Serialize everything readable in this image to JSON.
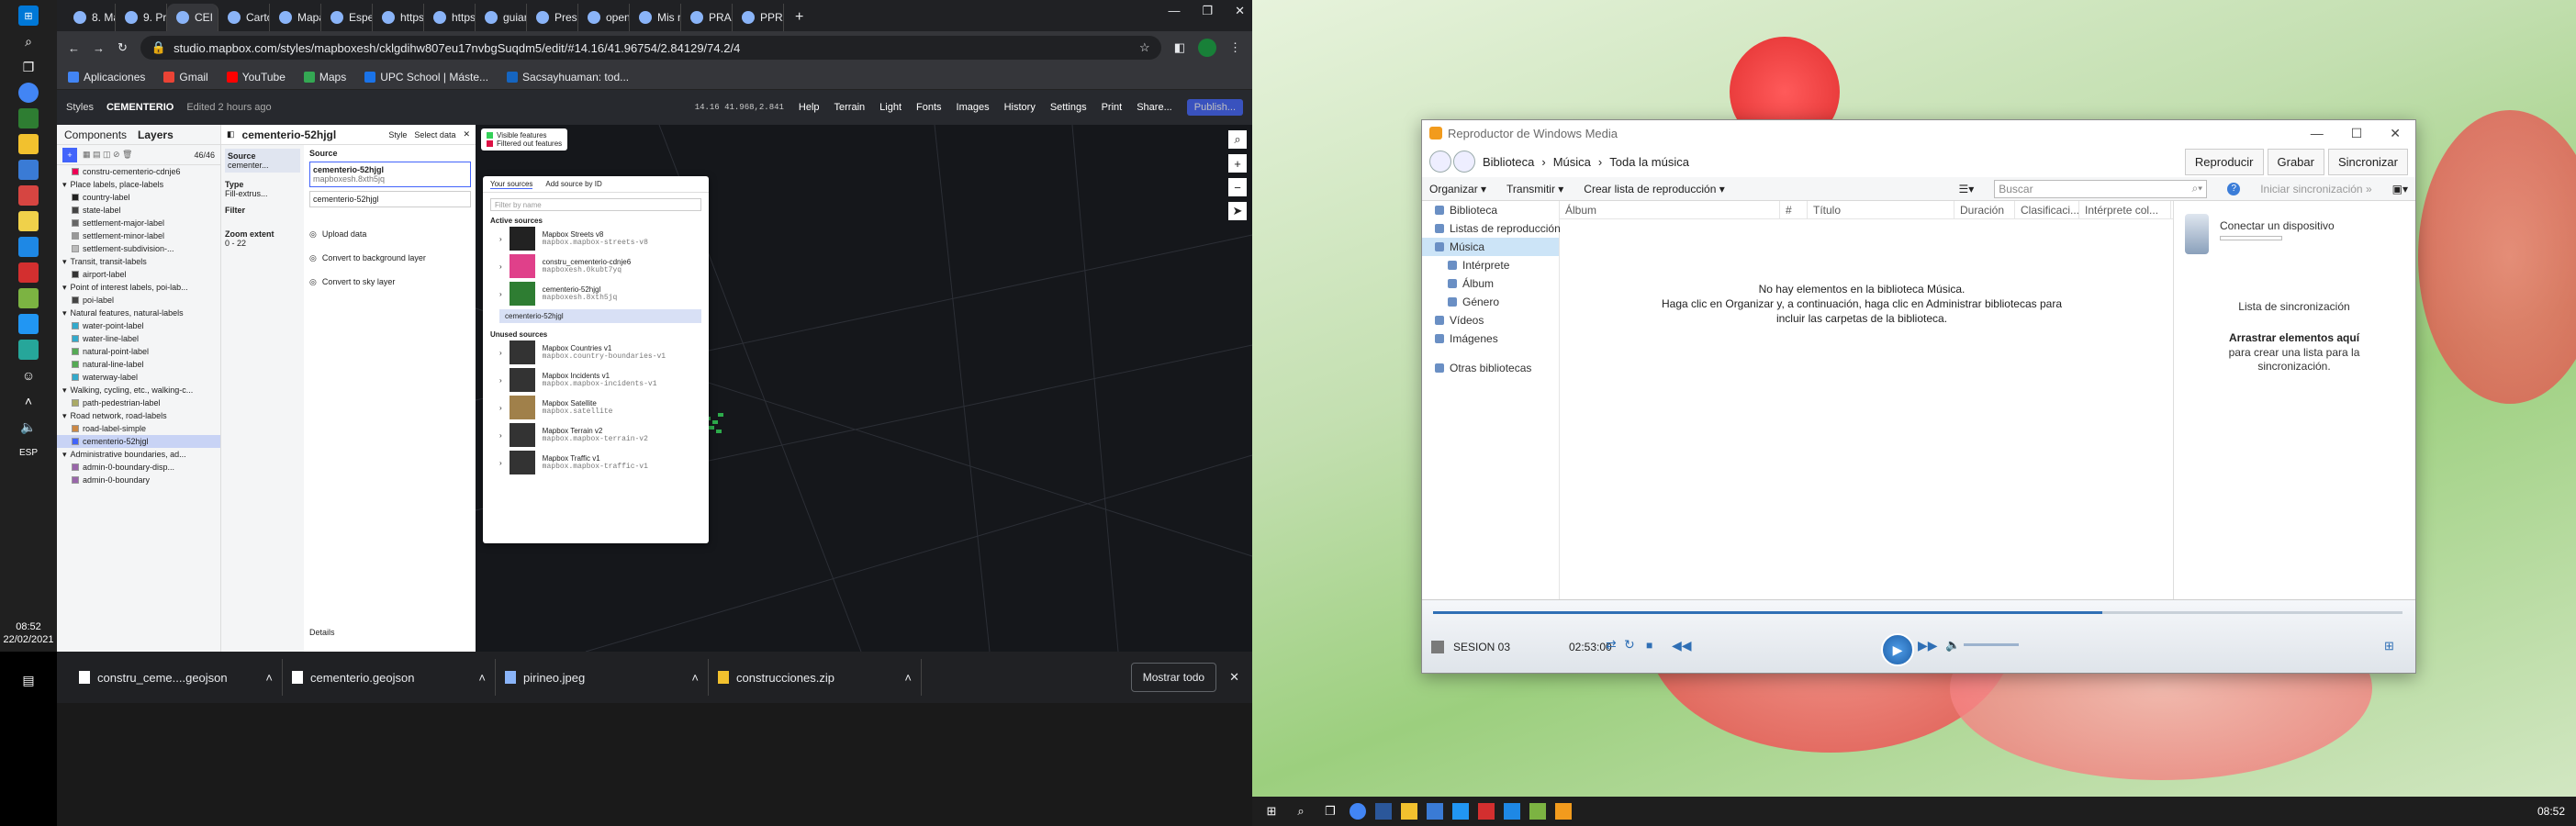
{
  "left_taskbar": {
    "icons": [
      "windows-icon",
      "search-icon",
      "task-view-icon",
      "chrome-icon",
      "mapbox-icon",
      "folder-icon",
      "store-icon",
      "mail-icon",
      "notes-icon",
      "vscode-icon",
      "acrobat-icon",
      "qgis-icon",
      "photos-icon",
      "app-icon",
      "people-icon"
    ],
    "time": "08:52",
    "date": "22/02/2021",
    "lang": "ESP"
  },
  "chrome": {
    "tabs": [
      "8. Map",
      "9. Prác",
      "CEI",
      "Cartog",
      "Mapa",
      "Especi",
      "https:/",
      "https:/",
      "guiar",
      "Presen",
      "opend",
      "Mis m",
      "PRACT",
      "PPRAC"
    ],
    "active_tab": 2,
    "url": "studio.mapbox.com/styles/mapboxesh/cklgdihw807eu17nvbgSuqdm5/edit/#14.16/41.96754/2.84129/74.2/4",
    "bookmarks": [
      "Aplicaciones",
      "Gmail",
      "YouTube",
      "Maps",
      "UPC School | Máste...",
      "Sacsayhuaman: tod..."
    ]
  },
  "mapbox": {
    "nav": {
      "styles": "Styles",
      "name": "CEMENTERIO",
      "edited": "Edited 2 hours ago"
    },
    "coords": "14.16 41.968,2.841",
    "menu": [
      "Help",
      "Terrain",
      "Light",
      "Fonts",
      "Images",
      "History",
      "Settings",
      "Print",
      "Share...",
      "Publish..."
    ],
    "panel_tabs": [
      "Components",
      "Layers"
    ],
    "layer_count": "46/46",
    "layers": [
      "constru-cementerio-cdnje6",
      "Place labels, place-labels",
      "country-label",
      "state-label",
      "settlement-major-label",
      "settlement-minor-label",
      "settlement-subdivision-...",
      "Transit, transit-labels",
      "airport-label",
      "Point of interest labels, poi-lab...",
      "poi-label",
      "Natural features, natural-labels",
      "water-point-label",
      "water-line-label",
      "natural-point-label",
      "natural-line-label",
      "waterway-label",
      "Walking, cycling, etc., walking-c...",
      "path-pedestrian-label",
      "Road network, road-labels",
      "road-label-simple",
      "cementerio-52hjgl",
      "Administrative boundaries, ad...",
      "admin-0-boundary-disp...",
      "admin-0-boundary"
    ],
    "selected_layer": "cementerio-52hjgl",
    "props": {
      "title": "cementerio-52hjgl",
      "tabs": [
        "Style",
        "Select data"
      ],
      "source_label": "Source",
      "source_name": "cementerio-52hjgl",
      "source_id": "mapboxesh.8xth5jq",
      "source_layer": "cementerio-52hjgl",
      "type_label": "Type",
      "type_value": "Fill-extrus...",
      "filter_label": "Filter",
      "zoom_label": "Zoom extent",
      "zoom_value": "0 - 22",
      "actions": [
        "Upload data",
        "Convert to background layer",
        "Convert to sky layer"
      ],
      "details": "Details",
      "src_short": "cementer..."
    },
    "map_legend": [
      "Visible features",
      "Filtered out features"
    ],
    "popup": {
      "tabs": [
        "Your sources",
        "Add source by ID"
      ],
      "filter_placeholder": "Filter by name",
      "active_header": "Active sources",
      "active": [
        {
          "name": "Mapbox Streets v8",
          "id": "mapbox.mapbox-streets-v8"
        },
        {
          "name": "constru_cementerio-cdnje6",
          "id": "mapboxesh.0kubt7yq"
        },
        {
          "name": "cementerio-52hjgl",
          "id": "mapboxesh.8xth5jq"
        }
      ],
      "active_child": "cementerio-52hjgl",
      "unused_header": "Unused sources",
      "unused": [
        {
          "name": "Mapbox Countries v1",
          "id": "mapbox.country-boundaries-v1"
        },
        {
          "name": "Mapbox Incidents v1",
          "id": "mapbox.mapbox-incidents-v1"
        },
        {
          "name": "Mapbox Satellite",
          "id": "mapbox.satellite"
        },
        {
          "name": "Mapbox Terrain v2",
          "id": "mapbox.mapbox-terrain-v2"
        },
        {
          "name": "Mapbox Traffic v1",
          "id": "mapbox.mapbox-traffic-v1"
        }
      ]
    }
  },
  "downloads": {
    "items": [
      "constru_ceme....geojson",
      "cementerio.geojson",
      "pirineo.jpeg",
      "construcciones.zip"
    ],
    "show_all": "Mostrar todo"
  },
  "wmp": {
    "title": "Reproductor de Windows Media",
    "breadcrumb": [
      "Biblioteca",
      "Música",
      "Toda la música"
    ],
    "tabs": [
      "Reproducir",
      "Grabar",
      "Sincronizar"
    ],
    "commands": [
      "Organizar",
      "Transmitir",
      "Crear lista de reproducción"
    ],
    "search_placeholder": "Buscar",
    "sync_label": "Iniciar sincronización",
    "nav": [
      "Biblioteca",
      "Listas de reproducción",
      "Música",
      "Intérprete",
      "Álbum",
      "Género",
      "Vídeos",
      "Imágenes",
      "Otras bibliotecas"
    ],
    "columns": [
      "Álbum",
      "#",
      "Título",
      "Duración",
      "Clasificaci...",
      "Intérprete col..."
    ],
    "empty_line1": "No hay elementos en la biblioteca Música.",
    "empty_line2": "Haga clic en Organizar y, a continuación, haga clic en Administrar bibliotecas para incluir las carpetas de la biblioteca.",
    "connect": "Conectar un dispositivo",
    "sync_list": "Lista de sincronización",
    "drag_title": "Arrastrar elementos aquí",
    "drag_sub": "para crear una lista para la sincronización.",
    "track": "SESION 03",
    "time": "02:53:00",
    "progress": 0.69,
    "accent": "#2f6fb5"
  },
  "right_taskbar": {
    "time": "08:52"
  }
}
